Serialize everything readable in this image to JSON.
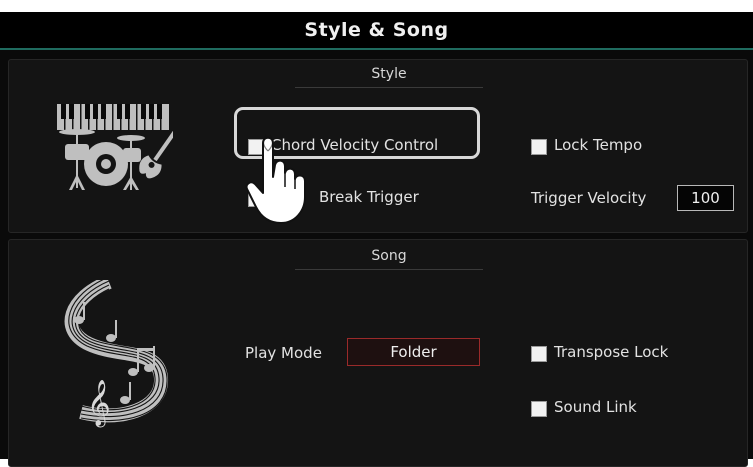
{
  "header": {
    "title": "Style & Song"
  },
  "style_section": {
    "title": "Style",
    "chord_velocity_control": {
      "label": "Chord Velocity Control",
      "checked": false
    },
    "break_trigger": {
      "label": "Break Trigger",
      "checked": false
    },
    "lock_tempo": {
      "label": "Lock Tempo",
      "checked": false
    },
    "trigger_velocity": {
      "label": "Trigger Velocity",
      "value": "100"
    }
  },
  "song_section": {
    "title": "Song",
    "play_mode": {
      "label": "Play Mode",
      "value": "Folder"
    },
    "transpose_lock": {
      "label": "Transpose Lock",
      "checked": false
    },
    "sound_link": {
      "label": "Sound Link",
      "checked": false
    }
  },
  "icons": {
    "style_icon": "instruments-icon",
    "song_icon": "music-notes-swirl-icon",
    "pointer": "hand-pointer-icon"
  },
  "colors": {
    "header_underline": "#1f6b5f",
    "select_border": "#9a2a2a",
    "highlight_frame": "#d8d8d8"
  }
}
